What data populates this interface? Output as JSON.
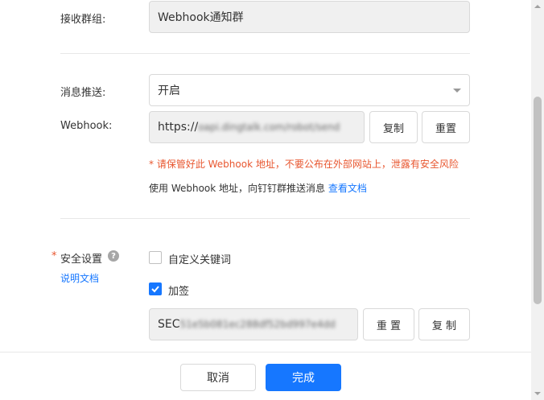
{
  "form": {
    "group_label": "接收群组:",
    "group_value": "Webhook通知群",
    "push_label": "消息推送:",
    "push_value": "开启",
    "webhook_label": "Webhook:",
    "webhook_prefix": "https://",
    "webhook_blurred": "oapi.dingtalk.com/robot/send",
    "copy_label": "复制",
    "reset_label": "重置",
    "warning_text": "* 请保管好此 Webhook 地址，不要公布在外部网站上，泄露有安全风险",
    "usage_text": "使用 Webhook 地址，向钉钉群推送消息",
    "docs_link": "查看文档",
    "security_required_mark": "*",
    "security_label": "安全设置",
    "security_docs_link": "说明文档",
    "keyword_option": "自定义关键词",
    "sign_option": "加签",
    "secret_prefix": "SEC",
    "secret_blurred": "51e5b081ec288df52bd997e4dd",
    "secret_reset_label": "重 置",
    "secret_copy_label": "复 制"
  },
  "footer": {
    "cancel_label": "取消",
    "done_label": "完成"
  },
  "colors": {
    "primary": "#1677ff",
    "warning": "#e8562f",
    "link": "#1677ff"
  }
}
